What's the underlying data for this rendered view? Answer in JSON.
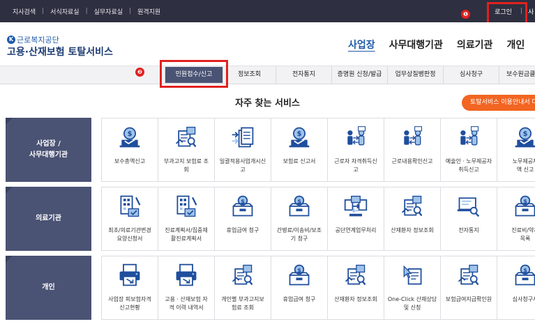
{
  "utility": {
    "links": [
      "지사검색",
      "서식자료실",
      "실무자료실",
      "원격지원"
    ],
    "login": "로그인",
    "next_cut": "사"
  },
  "annotations": {
    "badge1": "❶",
    "badge2": "❷"
  },
  "logo": {
    "org": "근로복지공단",
    "mark": "K",
    "title": "고용·산재보험 토탈서비스"
  },
  "main_nav": [
    "사업장",
    "사무대행기관",
    "의료기관",
    "개인"
  ],
  "sub_nav": [
    "민원접수/신고",
    "정보조회",
    "전자통지",
    "증명원 신청/발급",
    "업무상질병판정",
    "심사청구",
    "보수원금클릭"
  ],
  "section": {
    "title": "자주 찾는 서비스",
    "guide_button": "토탈서비스 이용안내서 다"
  },
  "rows": [
    {
      "title": "사업장 /\n사무대행기관",
      "items": [
        {
          "label": "보수총액신고",
          "icon": "money-laptop-icon"
        },
        {
          "label": "부과고지 보험료 조\n회",
          "icon": "document-search-icon"
        },
        {
          "label": "일괄적용사업개시신\n고",
          "icon": "documents-arrow-icon"
        },
        {
          "label": "보험료 신고서",
          "icon": "money-laptop-icon"
        },
        {
          "label": "근로자 자격취득신\n고",
          "icon": "people-arrows-icon"
        },
        {
          "label": "근로내용확인신고",
          "icon": "people-arrows-icon"
        },
        {
          "label": "예술인ㆍ노무제공자\n취득신고",
          "icon": "people-arrows-icon"
        },
        {
          "label": "노무제공자\n액 신고",
          "icon": "money-laptop-icon"
        }
      ]
    },
    {
      "title": "의료기관",
      "items": [
        {
          "label": "최초/의료기관변경\n요양신청서",
          "icon": "hospital-form-icon"
        },
        {
          "label": "진료계획서/집중재\n활진료계획서",
          "icon": "hospital-form-icon"
        },
        {
          "label": "휴업급여 청구",
          "icon": "money-box-icon"
        },
        {
          "label": "간병료/이송비/보조\n기 청구",
          "icon": "money-box-icon"
        },
        {
          "label": "공단연계업무처리",
          "icon": "transfer-icon"
        },
        {
          "label": "산재환자 정보조회",
          "icon": "document-search-icon"
        },
        {
          "label": "전자통지",
          "icon": "laptop-search-icon"
        },
        {
          "label": "진료비/약제\n목록",
          "icon": "money-box-icon"
        }
      ]
    },
    {
      "title": "개인",
      "items": [
        {
          "label": "사업장 피보험자격\n신고현황",
          "icon": "printer-icon"
        },
        {
          "label": "고용ㆍ산재보험 자\n격 이력 내역서",
          "icon": "printer-icon"
        },
        {
          "label": "개인별 부과고지보\n험료 조회",
          "icon": "document-search-icon"
        },
        {
          "label": "휴업급여 청구",
          "icon": "money-box-icon"
        },
        {
          "label": "산재환자 정보조회",
          "icon": "document-search-icon"
        },
        {
          "label": "One-Click 산재상담\n및 신청",
          "icon": "click-form-icon"
        },
        {
          "label": "보험급여지급확인원",
          "icon": "document-search-icon"
        },
        {
          "label": "심사청구서",
          "icon": "money-box-icon"
        }
      ]
    }
  ],
  "colors": {
    "row_head": "#4b5374",
    "accent": "#1f5aa8",
    "orange": "#f26522",
    "highlight": "#e0211f",
    "icon_blue": "#1f4e9c"
  }
}
